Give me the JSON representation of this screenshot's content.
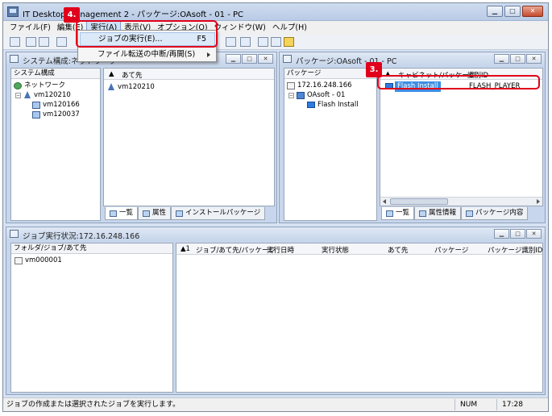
{
  "window": {
    "title": "IT Desktop Management 2 - パッケージ:OAsoft - 01 - PC"
  },
  "menubar": [
    {
      "label": "ファイル(F)"
    },
    {
      "label": "編集(E)"
    },
    {
      "label": "実行(A)"
    },
    {
      "label": "表示(V)"
    },
    {
      "label": "オプション(O)"
    },
    {
      "label": "ウィンドウ(W)"
    },
    {
      "label": "ヘルプ(H)"
    }
  ],
  "run_menu": {
    "items": [
      {
        "label": "ジョブの実行(E)...",
        "shortcut": "F5"
      },
      {
        "label": "ファイル転送の中断/再開(S)"
      }
    ]
  },
  "callouts": {
    "step3": "3.",
    "step4": "4."
  },
  "system_window": {
    "title": "システム構成:ネットワーク",
    "tree_header": "システム構成",
    "tree": [
      {
        "label": "ネットワーク"
      },
      {
        "label": "vm120210"
      },
      {
        "label": "vm120166"
      },
      {
        "label": "vm120037"
      }
    ],
    "list_header": "あて先",
    "list_rows": [
      {
        "label": "vm120210"
      }
    ],
    "tabs": [
      "一覧",
      "属性",
      "インストールパッケージ"
    ]
  },
  "package_window": {
    "title": "パッケージ:OAsoft - 01 - PC",
    "tree_header": "パッケージ",
    "tree": [
      {
        "label": "172.16.248.166"
      },
      {
        "label": "OAsoft - 01"
      },
      {
        "label": "Flash Install"
      }
    ],
    "col_headers": [
      "キャビネット/パッケージ",
      "識別ID"
    ],
    "rows": [
      {
        "name": "Flash Install",
        "id": "FLASH_PLAYER"
      }
    ],
    "tabs": [
      "一覧",
      "属性情報",
      "パッケージ内容"
    ]
  },
  "job_window": {
    "title": "ジョブ実行状況:172.16.248.166",
    "tree_header": "フォルダ/ジョブ/あて先",
    "tree": [
      {
        "label": "vm000001"
      }
    ],
    "sort_indicator": "▲1",
    "columns": [
      "ジョブ/あて先/パッケージ",
      "実行日時",
      "実行状態",
      "あて先",
      "パッケージ",
      "パッケージ識別ID"
    ]
  },
  "statusbar": {
    "message": "ジョブの作成または選択されたジョブを実行します。",
    "num": "NUM",
    "time": "17:28"
  },
  "colors": {
    "callout": "#e0001b",
    "selection": "#3b8ee5"
  }
}
